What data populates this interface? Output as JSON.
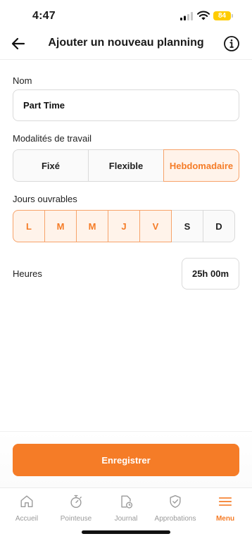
{
  "status_bar": {
    "time": "4:47",
    "battery": "84"
  },
  "header": {
    "title": "Ajouter un nouveau planning"
  },
  "form": {
    "name_label": "Nom",
    "name_value": "Part Time",
    "work_mode_label": "Modalités de travail",
    "work_modes": [
      {
        "label": "Fixé",
        "selected": false
      },
      {
        "label": "Flexible",
        "selected": false
      },
      {
        "label": "Hebdomadaire",
        "selected": true
      }
    ],
    "workdays_label": "Jours ouvrables",
    "days": [
      {
        "label": "L",
        "selected": true
      },
      {
        "label": "M",
        "selected": true
      },
      {
        "label": "M",
        "selected": true
      },
      {
        "label": "J",
        "selected": true
      },
      {
        "label": "V",
        "selected": true
      },
      {
        "label": "S",
        "selected": false
      },
      {
        "label": "D",
        "selected": false
      }
    ],
    "hours_label": "Heures",
    "hours_value": "25h 00m"
  },
  "save_button": "Enregistrer",
  "tabs": [
    {
      "label": "Accueil",
      "icon": "home-icon",
      "active": false
    },
    {
      "label": "Pointeuse",
      "icon": "stopwatch-icon",
      "active": false
    },
    {
      "label": "Journal",
      "icon": "journal-clock-icon",
      "active": false
    },
    {
      "label": "Approbations",
      "icon": "shield-check-icon",
      "active": false
    },
    {
      "label": "Menu",
      "icon": "menu-icon",
      "active": true
    }
  ],
  "colors": {
    "accent": "#f57c27",
    "accent_light": "#fff3ea",
    "accent_border": "#f7a36a",
    "battery": "#ffcc00"
  }
}
